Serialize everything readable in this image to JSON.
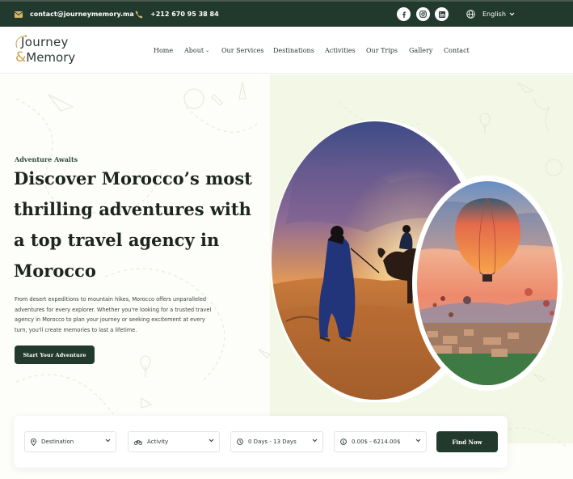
{
  "topbar": {
    "email": "contact@journeymemory.ma",
    "phone": "+212 670 95 38 84",
    "social": [
      "facebook-icon",
      "instagram-icon",
      "linkedin-icon"
    ],
    "language": "English"
  },
  "header": {
    "logo": {
      "line1": "Journey",
      "amp": "&",
      "line2": "Memory"
    },
    "nav": [
      {
        "label": "Home"
      },
      {
        "label": "About",
        "has_dropdown": true
      },
      {
        "label": "Our Services"
      },
      {
        "label": "Destinations"
      },
      {
        "label": "Activities"
      },
      {
        "label": "Our Trips"
      },
      {
        "label": "Gallery"
      },
      {
        "label": "Contact"
      }
    ]
  },
  "hero": {
    "eyebrow": "Adventure Awaits",
    "headline_lines": [
      "Discover Morocco’s most",
      "thrilling adventures with",
      "a top travel agency in",
      "Morocco"
    ],
    "paragraph_lines": [
      "From desert expeditions to mountain hikes, Morocco offers unparalleled",
      "adventures for every explorer. Whether you're looking for a trusted travel",
      "agency in Morocco to plan your journey or seeking excitement at every",
      "turn, you'll create memories to last a lifetime."
    ],
    "cta_label": "Start Your Adventure"
  },
  "search": {
    "destination": "Destination",
    "activity": "Activity",
    "duration": "0 Days - 13 Days",
    "price": "0.00$ - 6214.00$",
    "button": "Find Now"
  },
  "colors": {
    "primary": "#22392e",
    "accent": "#d6b66a",
    "hero_right_bg": "#f3f8e6"
  }
}
